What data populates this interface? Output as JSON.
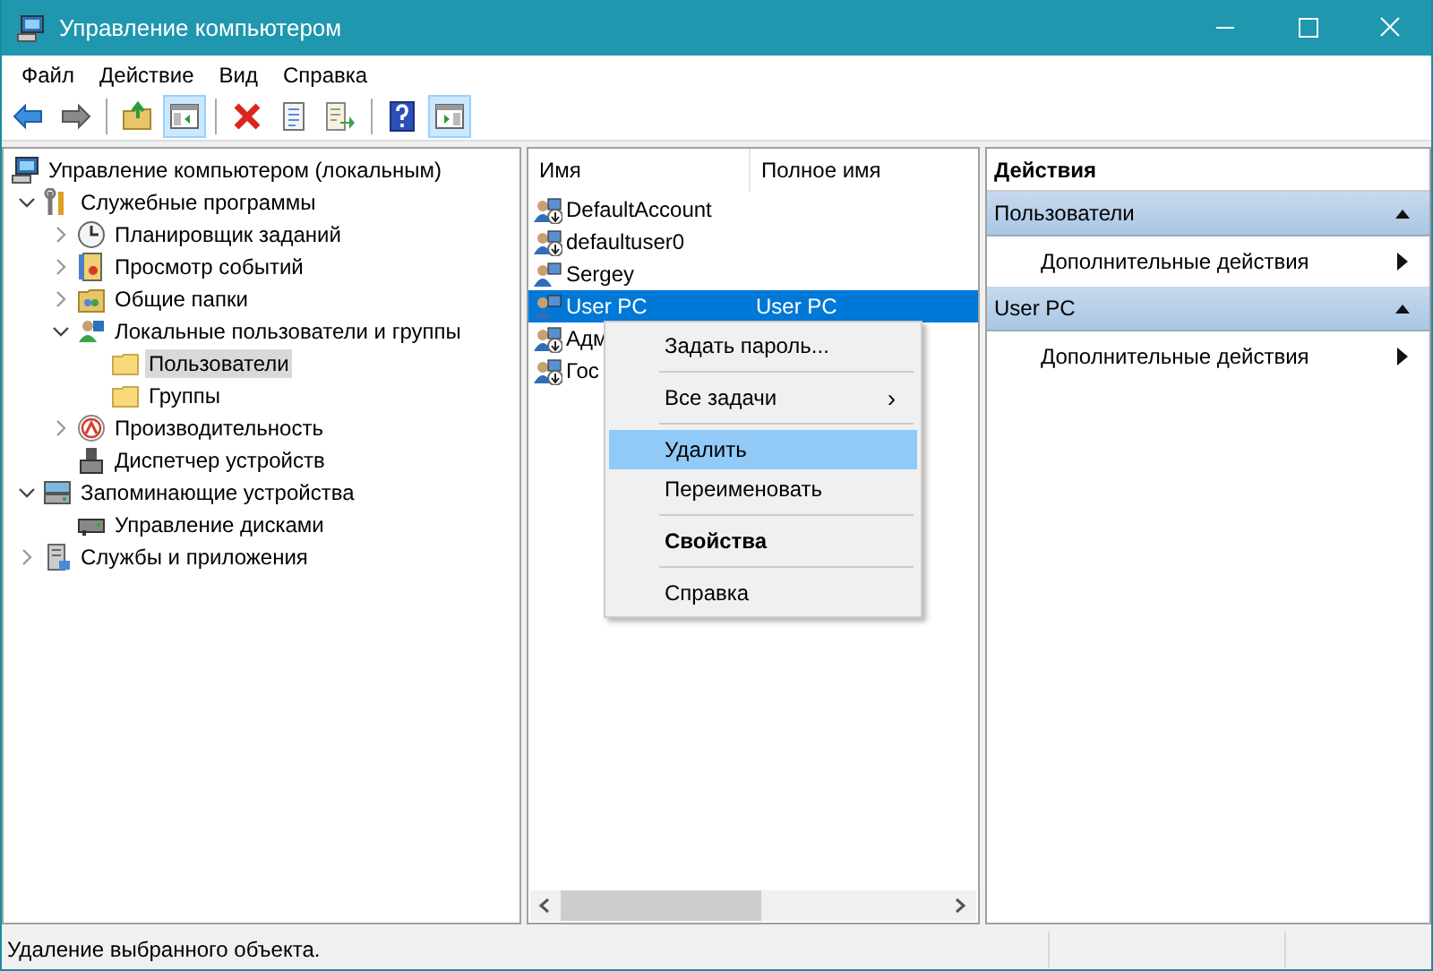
{
  "window": {
    "title": "Управление компьютером"
  },
  "menu": [
    "Файл",
    "Действие",
    "Вид",
    "Справка"
  ],
  "toolbar": [
    {
      "kind": "back",
      "pressed": false
    },
    {
      "kind": "forward",
      "pressed": false
    },
    {
      "kind": "sep"
    },
    {
      "kind": "up",
      "pressed": false
    },
    {
      "kind": "tree",
      "pressed": true
    },
    {
      "kind": "sep"
    },
    {
      "kind": "delete",
      "pressed": false
    },
    {
      "kind": "props",
      "pressed": false
    },
    {
      "kind": "export",
      "pressed": false
    },
    {
      "kind": "sep"
    },
    {
      "kind": "help",
      "pressed": false
    },
    {
      "kind": "pane",
      "pressed": true
    }
  ],
  "tree": [
    {
      "label": "Управление компьютером (локальным)",
      "selected": false,
      "children": [
        {
          "label": "Служебные программы",
          "expanded": true,
          "selected": false,
          "children": [
            {
              "label": "Планировщик заданий",
              "expanded": false,
              "selected": false
            },
            {
              "label": "Просмотр событий",
              "expanded": false,
              "selected": false
            },
            {
              "label": "Общие папки",
              "expanded": false,
              "selected": false
            },
            {
              "label": "Локальные пользователи и группы",
              "expanded": true,
              "selected": false,
              "children": [
                {
                  "label": "Пользователи",
                  "selected": true
                },
                {
                  "label": "Группы",
                  "selected": false
                }
              ]
            },
            {
              "label": "Производительность",
              "expanded": false,
              "selected": false
            },
            {
              "label": "Диспетчер устройств",
              "selected": false
            }
          ]
        },
        {
          "label": "Запоминающие устройства",
          "expanded": true,
          "selected": false,
          "children": [
            {
              "label": "Управление дисками",
              "selected": false
            }
          ]
        },
        {
          "label": "Службы и приложения",
          "expanded": false,
          "selected": false
        }
      ]
    }
  ],
  "list": {
    "columns": [
      "Имя",
      "Полное имя"
    ],
    "rows": [
      {
        "name": "DefaultAccount",
        "disabled": true,
        "selected": false
      },
      {
        "name": "defaultuser0",
        "disabled": true,
        "selected": false
      },
      {
        "name": "Sergey",
        "disabled": false,
        "selected": false
      },
      {
        "name": "User PC",
        "full_name": "User PC",
        "disabled": false,
        "selected": true
      },
      {
        "name": "Адм",
        "disabled": true,
        "selected": false
      },
      {
        "name": "Гос",
        "disabled": true,
        "selected": false
      }
    ]
  },
  "context_menu": [
    {
      "kind": "item",
      "label": "Задать пароль...",
      "selected": false
    },
    {
      "kind": "sep"
    },
    {
      "kind": "submenu",
      "label": "Все задачи",
      "arrow": "›",
      "selected": false
    },
    {
      "kind": "sep"
    },
    {
      "kind": "item",
      "label": "Удалить",
      "selected": true
    },
    {
      "kind": "item",
      "label": "Переименовать",
      "selected": false
    },
    {
      "kind": "sep"
    },
    {
      "kind": "default",
      "label": "Свойства",
      "selected": false
    },
    {
      "kind": "sep"
    },
    {
      "kind": "item",
      "label": "Справка",
      "selected": false
    }
  ],
  "actions": {
    "title": "Действия",
    "sections": [
      {
        "title": "Пользователи",
        "expanded": true,
        "items": [
          "Дополнительные действия"
        ]
      },
      {
        "title": "User PC",
        "expanded": true,
        "items": [
          "Дополнительные действия"
        ]
      }
    ]
  },
  "status_bar": {
    "text": "Удаление выбранного объекта."
  }
}
